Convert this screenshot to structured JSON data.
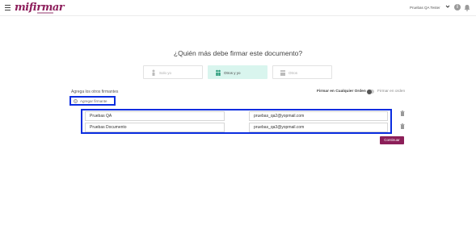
{
  "header": {
    "logo_text": "mifirmar",
    "user_name": "Pruebas QA Tester",
    "info_glyph": "i",
    "icons": [
      "hamburger-icon",
      "chevron-down-icon",
      "info-icon",
      "bell-icon"
    ]
  },
  "main": {
    "title": "¿Quién más debe firmar este documento?",
    "options": [
      {
        "label": "Solo yo",
        "icon": "person-icon",
        "selected": false
      },
      {
        "label": "Otros y yo",
        "icon": "people-icon",
        "selected": true
      },
      {
        "label": "Otros",
        "icon": "group-icon",
        "selected": false
      }
    ],
    "add_signers_label": "Agrega los otros firmantes",
    "add_signer_button": "Agregar firmante",
    "add_signer_plus": "+",
    "order_label": "Firmar en Cualquier Orden",
    "order_option": "Firmar en orden",
    "signers": [
      {
        "name": "Pruebas QA",
        "email": "pruebas_qa2@yopmail.com"
      },
      {
        "name": "Pruebas Documento",
        "email": "pruebas_qa3@yopmail.com"
      }
    ],
    "continue_button": "Continuar"
  },
  "colors": {
    "brand": "#8c1f59",
    "selected_option_bg": "#d9f5ee",
    "highlight_border": "#0a2de0"
  }
}
